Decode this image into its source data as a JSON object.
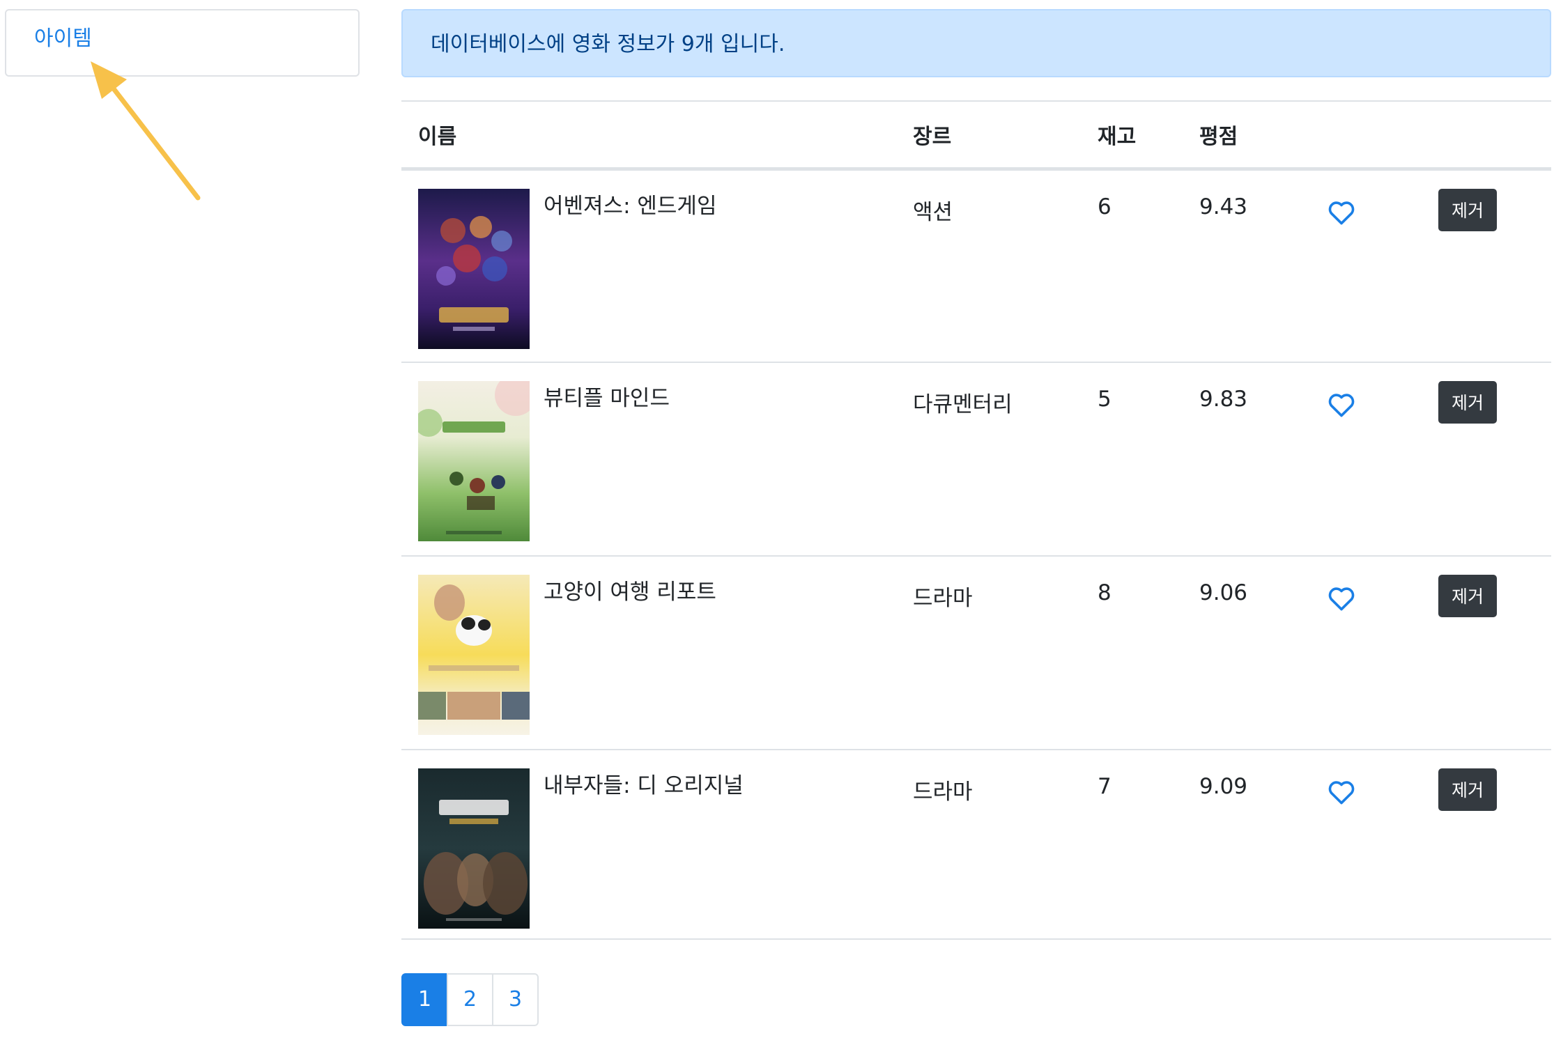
{
  "sidebar": {
    "item_label": "아이템"
  },
  "alert": {
    "message": "데이터베이스에 영화 정보가 9개 입니다."
  },
  "table": {
    "headers": {
      "name": "이름",
      "genre": "장르",
      "stock": "재고",
      "rating": "평점"
    },
    "rows": [
      {
        "title": "어벤져스: 엔드게임",
        "genre": "액션",
        "stock": "6",
        "rating": "9.43",
        "delete_label": "제거",
        "poster_icon": "movie-poster-avengers"
      },
      {
        "title": "뷰티플 마인드",
        "genre": "다큐멘터리",
        "stock": "5",
        "rating": "9.83",
        "delete_label": "제거",
        "poster_icon": "movie-poster-beautiful-mind"
      },
      {
        "title": "고양이 여행 리포트",
        "genre": "드라마",
        "stock": "8",
        "rating": "9.06",
        "delete_label": "제거",
        "poster_icon": "movie-poster-cat-travel"
      },
      {
        "title": "내부자들: 디 오리지널",
        "genre": "드라마",
        "stock": "7",
        "rating": "9.09",
        "delete_label": "제거",
        "poster_icon": "movie-poster-insiders"
      }
    ]
  },
  "pagination": {
    "pages": [
      "1",
      "2",
      "3"
    ],
    "current": "1"
  },
  "colors": {
    "link": "#1a7fe6",
    "alert_bg": "#cce5ff",
    "alert_text": "#004085",
    "button_dark": "#343a40",
    "arrow": "#f7c14a"
  }
}
